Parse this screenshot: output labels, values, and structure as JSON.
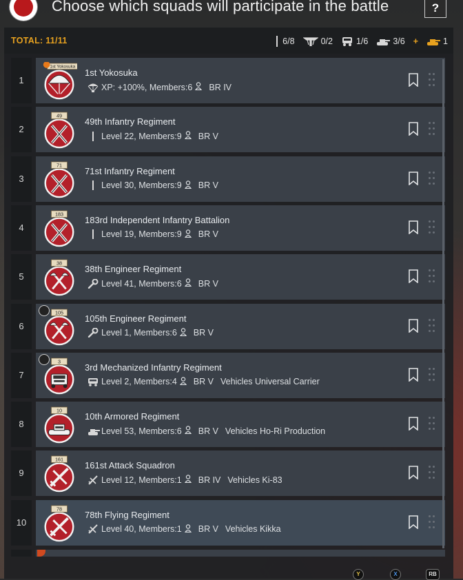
{
  "header": {
    "title": "Choose which squads will participate in the battle",
    "help_label": "?"
  },
  "totals": {
    "label": "TOTAL: 11/11",
    "infantry": "6/8",
    "paratroopers": "0/2",
    "vehicles": "1/6",
    "tanks": "3/6",
    "plus": "+",
    "bonus_tanks": "1"
  },
  "squads": [
    {
      "num": "1",
      "name": "1st Yokosuka",
      "info": "XP: +100%, Members:6",
      "br": "BR IV",
      "vehicles": "",
      "icon": "parachute-icon",
      "emblem": "paratroop",
      "tag": "1st Yokosuka"
    },
    {
      "num": "2",
      "name": "49th Infantry Regiment",
      "info": "Level 22, Members:9",
      "br": "BR V",
      "vehicles": "",
      "icon": "rifle-icon",
      "emblem": "rifles",
      "tag": "49"
    },
    {
      "num": "3",
      "name": "71st Infantry Regiment",
      "info": "Level 30, Members:9",
      "br": "BR V",
      "vehicles": "",
      "icon": "rifle-icon",
      "emblem": "rifles",
      "tag": "71"
    },
    {
      "num": "4",
      "name": "183rd Independent Infantry Battalion",
      "info": "Level 19, Members:9",
      "br": "BR V",
      "vehicles": "",
      "icon": "rifle-icon",
      "emblem": "rifles",
      "tag": "183"
    },
    {
      "num": "5",
      "name": "38th Engineer Regiment",
      "info": "Level 41, Members:6",
      "br": "BR V",
      "vehicles": "",
      "icon": "wrench-icon",
      "emblem": "axes",
      "tag": "38"
    },
    {
      "num": "6",
      "name": "105th Engineer Regiment",
      "info": "Level 1, Members:6",
      "br": "BR V",
      "vehicles": "",
      "icon": "wrench-icon",
      "emblem": "axes",
      "tag": "105"
    },
    {
      "num": "7",
      "name": "3rd Mechanized Infantry Regiment",
      "info": "Level 2, Members:4",
      "br": "BR V",
      "vehicles": "Vehicles Universal Carrier",
      "icon": "truck-icon",
      "emblem": "truck",
      "tag": "3"
    },
    {
      "num": "8",
      "name": "10th Armored Regiment",
      "info": "Level 53, Members:6",
      "br": "BR V",
      "vehicles": "Vehicles Ho-Ri Production",
      "icon": "tank-icon",
      "emblem": "tank",
      "tag": "10"
    },
    {
      "num": "9",
      "name": "161st Attack Squadron",
      "info": "Level 12, Members:1",
      "br": "BR IV",
      "vehicles": "Vehicles Ki-83",
      "icon": "plane-icon",
      "emblem": "plane",
      "tag": "161"
    },
    {
      "num": "10",
      "name": "78th Flying Regiment",
      "info": "Level 40, Members:1",
      "br": "BR V",
      "vehicles": "Vehicles Kikka",
      "icon": "plane-icon",
      "emblem": "plane",
      "tag": "78"
    }
  ],
  "footer": {
    "y": "Y",
    "x": "X",
    "rb": "RB"
  },
  "colors": {
    "accent": "#e8a21f",
    "card": "#3a4048",
    "selected": "#3f4a56",
    "emblem_red": "#b3202a"
  }
}
